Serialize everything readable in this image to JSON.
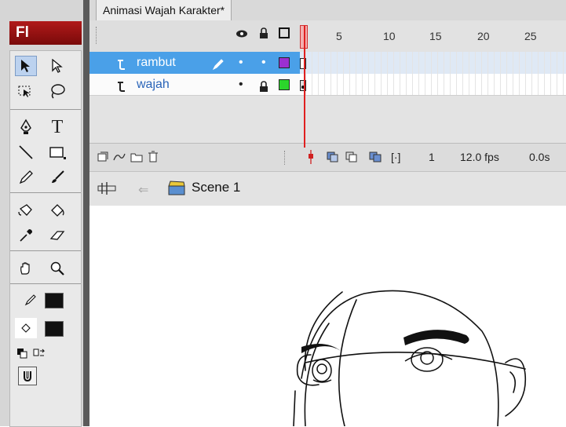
{
  "app": {
    "logo": "Fl"
  },
  "document_tab": {
    "title": "Animasi Wajah Karakter*"
  },
  "timeline": {
    "ruler": [
      "5",
      "10",
      "15",
      "20",
      "25"
    ],
    "layers": [
      {
        "name": "rambut",
        "selected": true,
        "outline_color": "#9b2fd1"
      },
      {
        "name": "wajah",
        "selected": false,
        "outline_color": "#2bd52b"
      }
    ],
    "footer": {
      "current_frame": "1",
      "fps": "12.0 fps",
      "time": "0.0s"
    }
  },
  "scene": {
    "label": "Scene 1"
  },
  "colors": {
    "accent": "#4aa0e8",
    "logo_bg": "#9b1515",
    "playhead": "#e02020"
  }
}
